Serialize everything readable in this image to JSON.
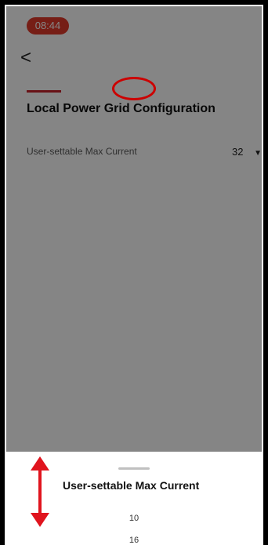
{
  "status_bar": {
    "time": "08:44",
    "signal": ":::",
    "wifi_icon": "wifi-icon",
    "battery_icon": "battery-icon"
  },
  "nav": {
    "back_icon": "chevron-left-icon",
    "back_glyph": "<"
  },
  "page": {
    "title": "Local Power Grid Configuration"
  },
  "setting": {
    "label": "User-settable Max Current",
    "value": "32",
    "dropdown_icon": "caret-down-icon",
    "caret": "▼"
  },
  "picker": {
    "title": "User-settable Max Current",
    "options": [
      "10",
      "16"
    ],
    "selected": "16"
  },
  "colors": {
    "accent": "#c8232c",
    "time_pill": "#e23b2b",
    "annotation": "#cc0000"
  }
}
